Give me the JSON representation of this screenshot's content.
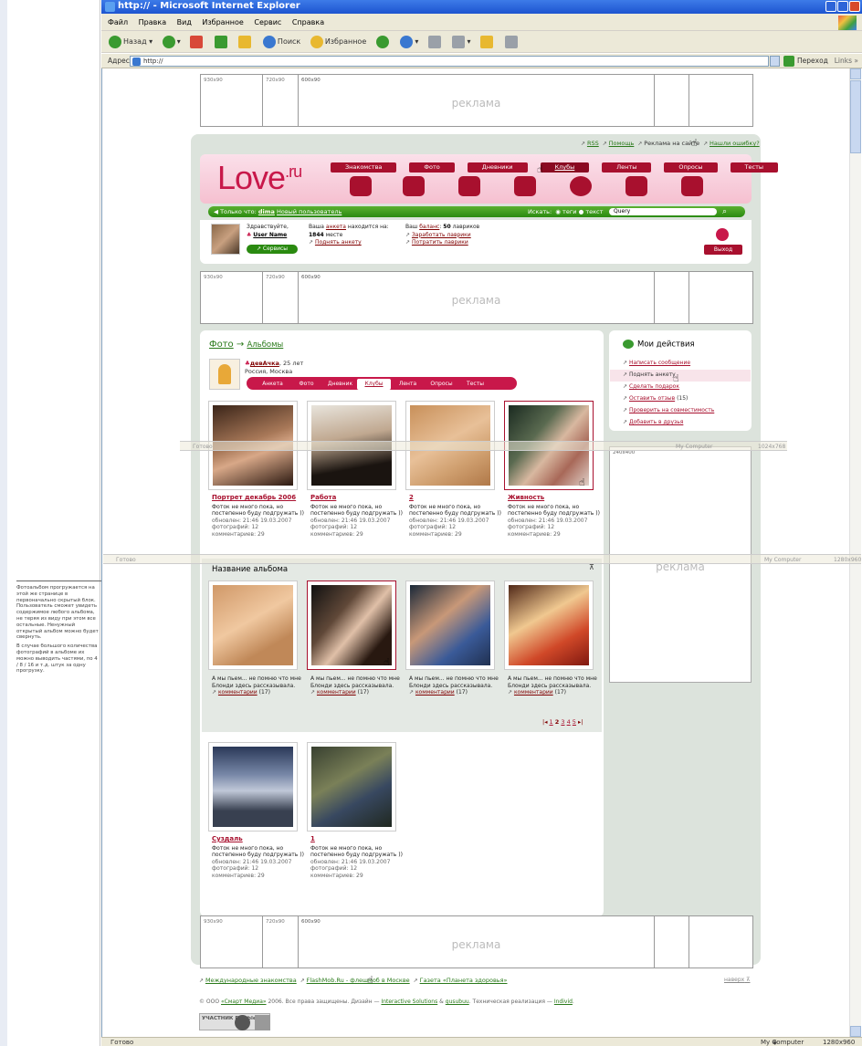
{
  "browser": {
    "title": "http:// - Microsoft Internet Explorer",
    "menu": [
      "Файл",
      "Правка",
      "Вид",
      "Избранное",
      "Сервис",
      "Справка"
    ],
    "toolbar": {
      "back": "Назад",
      "search": "Поиск",
      "favorites": "Избранное"
    },
    "address_label": "Адрес:",
    "address_value": "http://",
    "go": "Переход",
    "links": "Links",
    "status": "Готово",
    "zone": "My Computer",
    "resolution": "1280x960 2x"
  },
  "ads": {
    "top": {
      "s1": "930x90",
      "s2": "720x90",
      "s3": "600x90",
      "label": "реклама"
    },
    "mid": {
      "s1": "930x90",
      "s2": "720x90",
      "s3": "600x90",
      "label": "реклама"
    },
    "bottom": {
      "s1": "930x90",
      "s2": "720x90",
      "s3": "600x90",
      "label": "реклама"
    },
    "side": {
      "size": "240x400",
      "label": "реклама"
    }
  },
  "ghost_status": {
    "a": {
      "left": "Готово",
      "zone": "My Computer",
      "res": "1024x768"
    },
    "b": {
      "left": "Готово",
      "zone": "My Computer",
      "res": "1280x960"
    }
  },
  "toplinks": {
    "rss": "RSS",
    "help": "Помощь",
    "ads": "Реклама на сайте",
    "errors": "Нашли ошибку?"
  },
  "header": {
    "logo": "Love",
    "logo_suffix": ".ru",
    "nav": [
      "Знакомства",
      "Фото",
      "Дневники",
      "Клубы",
      "Ленты",
      "Опросы",
      "Тесты"
    ],
    "bar_only": "Только что:",
    "bar_user": "dima",
    "bar_new": "Новый пользователь",
    "search_label": "Искать:",
    "search_opt1": "теги",
    "search_opt2": "текст",
    "search_value": "Query"
  },
  "userpanel": {
    "hello": "Здравствуйте,",
    "username": "User Name",
    "services": "Сервисы",
    "rank_pre": "Ваша",
    "rank_link": "анкета",
    "rank_post": "находится на:",
    "rank_value": "1844",
    "rank_word": "месте",
    "raise": "Поднять анкету",
    "balance_pre": "Ваш",
    "balance_link": "баланс",
    "balance_value": "50",
    "balance_word": "лавриков",
    "earn": "Заработать лаврики",
    "spend": "Потратить лаврики",
    "exit": "Выход"
  },
  "albums": {
    "crumb_photo": "Фото",
    "crumb_arrow": "→",
    "crumb_albums": "Альбомы",
    "user_name": "девАчка",
    "user_age": ", 25 лет",
    "user_loc": "Россия, Москва",
    "tabs": [
      "Анкета",
      "Фото",
      "Дневник",
      "Клубы",
      "Лента",
      "Опросы",
      "Тесты"
    ],
    "grid1": [
      {
        "title": "Портрет декабрь 2006",
        "desc": "Фоток не много пока, но постепенно буду подгружать ))",
        "updated": "обновлен: 21:46 19.03.2007",
        "photos": "фотографий: 12",
        "comments": "комментариев: 29"
      },
      {
        "title": "Работа",
        "desc": "Фоток не много пока, но постепенно буду подгружать ))",
        "updated": "обновлен: 21:46 19.03.2007",
        "photos": "фотографий: 12",
        "comments": "комментариев: 29"
      },
      {
        "title": "2",
        "desc": "Фоток не много пока, но постепенно буду подгружать ))",
        "updated": "обновлен: 21:46 19.03.2007",
        "photos": "фотографий: 12",
        "comments": "комментариев: 29"
      },
      {
        "title": "Живность",
        "desc": "Фоток не много пока, но постепенно буду подгружать ))",
        "updated": "обновлен: 21:46 19.03.2007",
        "photos": "фотографий: 12",
        "comments": "комментариев: 29"
      }
    ],
    "album_name": "Название альбома",
    "grid2": [
      {
        "desc": "А мы пьем... не помню что мне Блонди здесь рассказывала.",
        "comments": "комментарии",
        "count": "(17)"
      },
      {
        "desc": "А мы пьем... не помню что мне Блонди здесь рассказывала.",
        "comments": "комментарии",
        "count": "(17)"
      },
      {
        "desc": "А мы пьем... не помню что мне Блонди здесь рассказывала.",
        "comments": "комментарии",
        "count": "(17)"
      },
      {
        "desc": "А мы пьем... не помню что мне Блонди здесь рассказывала.",
        "comments": "комментарии",
        "count": "(17)"
      }
    ],
    "pager": [
      "1",
      "2",
      "3",
      "4",
      "5"
    ],
    "grid3": [
      {
        "title": "Суздаль",
        "desc": "Фоток не много пока, но постепенно буду подгружать ))",
        "updated": "обновлен: 21:46 19.03.2007",
        "photos": "фотографий: 12",
        "comments": "комментариев: 29"
      },
      {
        "title": "1",
        "desc": "Фоток не много пока, но постепенно буду подгружать ))",
        "updated": "обновлен: 21:46 19.03.2007",
        "photos": "фотографий: 12",
        "comments": "комментариев: 29"
      }
    ]
  },
  "actions": {
    "title": "Мои действия",
    "items": [
      "Написать сообщение",
      "Поднять анкету",
      "Сделать подарок",
      "Оставить отзыв",
      "Проверить на совместимость",
      "Добавить в друзья"
    ],
    "review_count": "(15)"
  },
  "footer": {
    "links": [
      "Международные знакомства",
      "FlashMob.Ru - флешмоб в Москве",
      "Газета «Планета здоровья»"
    ],
    "up": "наверх",
    "copyright_pre": "© ООО",
    "copyright_company": "«Смарт Медиа»",
    "copyright_mid": "2006. Все права защищены. Дизайн —",
    "design1": "Interactive Solutions",
    "amp": "&",
    "design2": "gusubuu",
    "tech": ". Техническая реализация —",
    "tech_name": "Individ",
    "rambler": "УЧАСТНИК Rambler's",
    "top100": "TOP 100"
  },
  "note": {
    "p1": "Фотоальбом прогружается на этой же странице в первоначально скрытый блок. Пользователь сможет увидеть содержимое любого альбома, не теряя из виду при этом все остальные. Ненужный открытый альбом можно будет свернуть.",
    "p2": "В случае большого количества фотографий в альбоме их можно выводить частями, по 4 / 8 / 16 и т.д. штук за одну прогрузку."
  },
  "colors": {
    "brand": "#c8184a",
    "green": "#2a8a10",
    "link": "#800000"
  }
}
